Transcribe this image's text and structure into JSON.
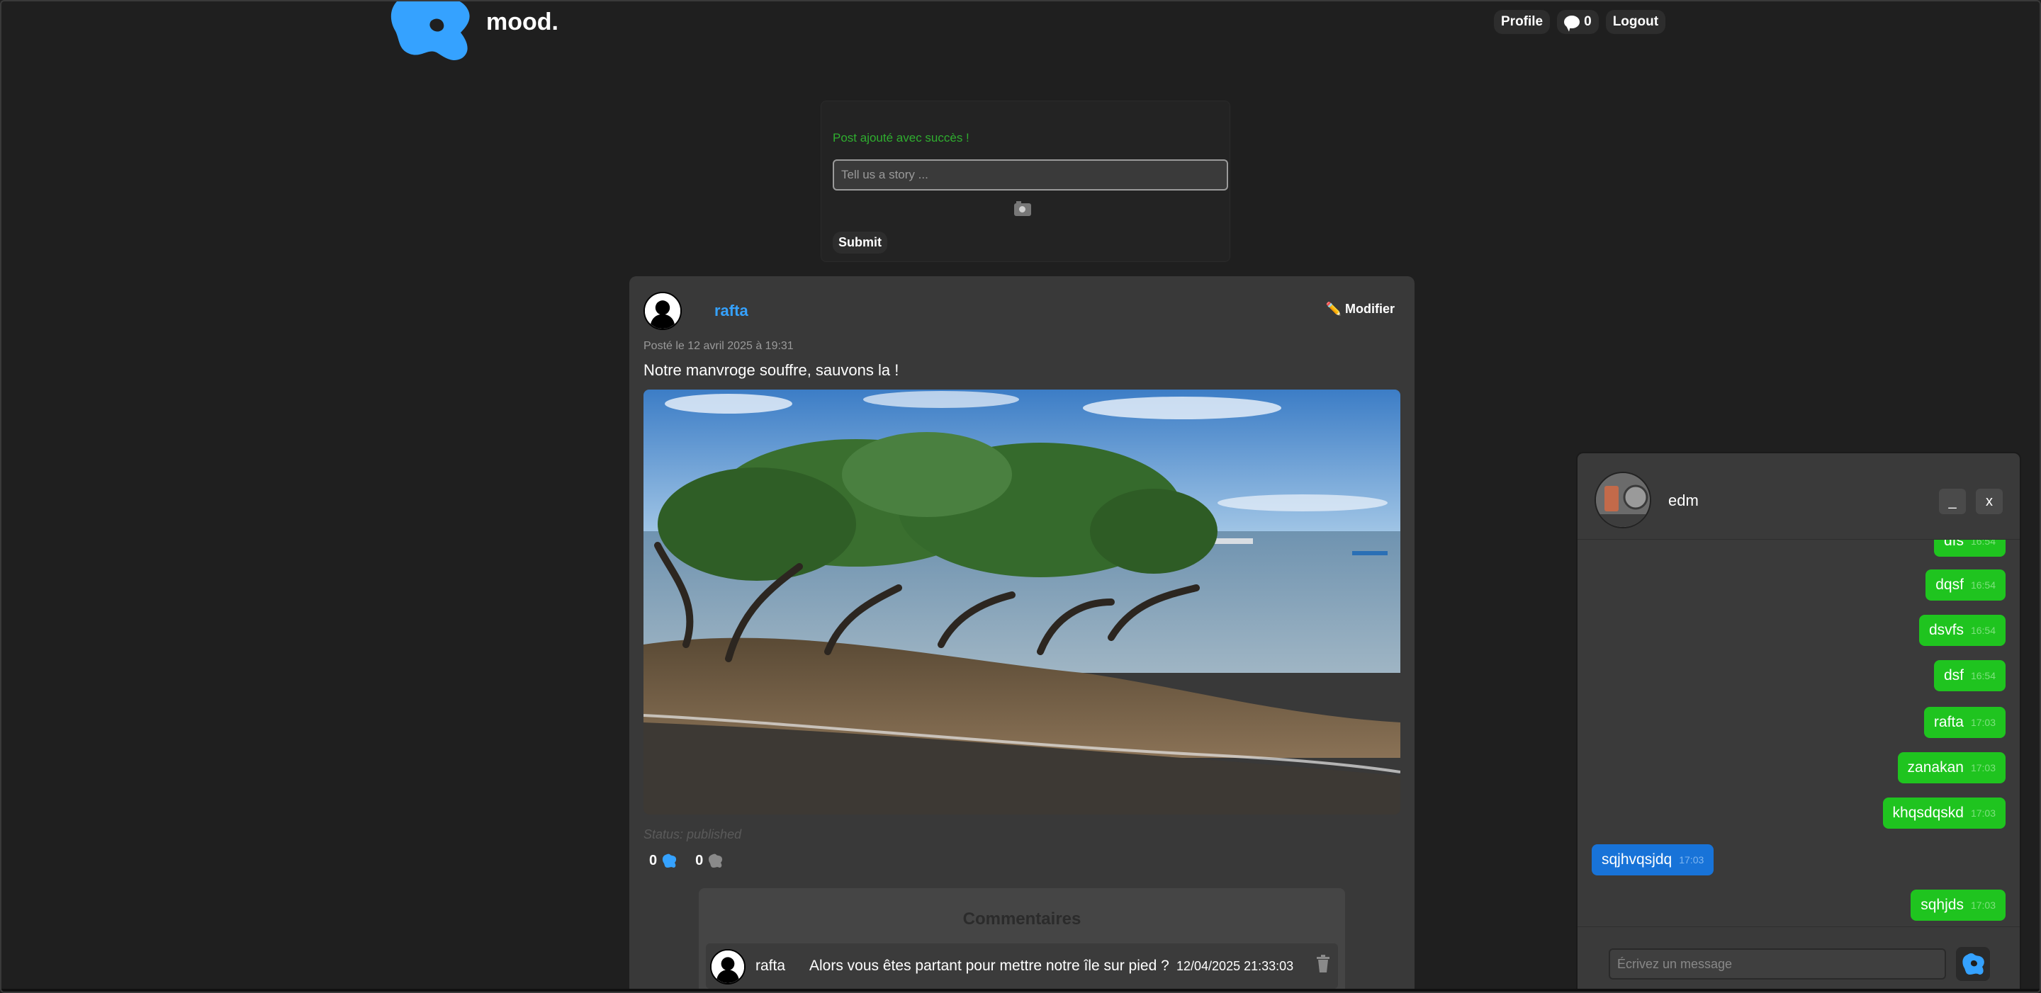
{
  "brand": {
    "name": "mood.",
    "logo_icon": "blue-blob-logo-icon",
    "accent": "#35a2ff"
  },
  "nav": {
    "profile_label": "Profile",
    "messages_icon": "speech-bubble-icon",
    "messages_count": "0",
    "logout_label": "Logout"
  },
  "composer": {
    "success_message": "Post ajouté avec succès !",
    "story_placeholder": "Tell us a story ...",
    "camera_icon": "camera-icon",
    "submit_label": "Submit"
  },
  "post": {
    "author": "rafta",
    "edit_label": "✏️ Modifier",
    "date": "Posté le 12 avril 2025 à 19:31",
    "text": "Notre manvroge souffre, sauvons la !",
    "status": "Status: published",
    "likes": "0",
    "dislikes": "0",
    "like_icon": "blue-blob-icon",
    "dislike_icon": "grey-blob-icon",
    "image_icon": "mangrove-photo"
  },
  "comments": {
    "title": "Commentaires",
    "items": [
      {
        "author": "rafta",
        "text": "Alors vous êtes partant pour mettre notre île sur pied ?",
        "time": "12/04/2025 21:33:03"
      }
    ]
  },
  "chat": {
    "contact": "edm",
    "minimize_label": "_",
    "close_label": "x",
    "input_placeholder": "Écrivez un message",
    "send_icon": "send-blob-icon",
    "colors": {
      "mine": "#1fc41f",
      "theirs": "#1873d8"
    },
    "messages": [
      {
        "from": "me",
        "text": "dfs",
        "time": "16:54"
      },
      {
        "from": "me",
        "text": "dqsf",
        "time": "16:54"
      },
      {
        "from": "me",
        "text": "dsvfs",
        "time": "16:54"
      },
      {
        "from": "me",
        "text": "dsf",
        "time": "16:54"
      },
      {
        "from": "me",
        "text": "rafta",
        "time": "17:03"
      },
      {
        "from": "me",
        "text": "zanakan",
        "time": "17:03"
      },
      {
        "from": "me",
        "text": "khqsdqskd",
        "time": "17:03"
      },
      {
        "from": "them",
        "text": "sqjhvqsjdq",
        "time": "17:03"
      },
      {
        "from": "me",
        "text": "sqhjds",
        "time": "17:03"
      }
    ]
  }
}
